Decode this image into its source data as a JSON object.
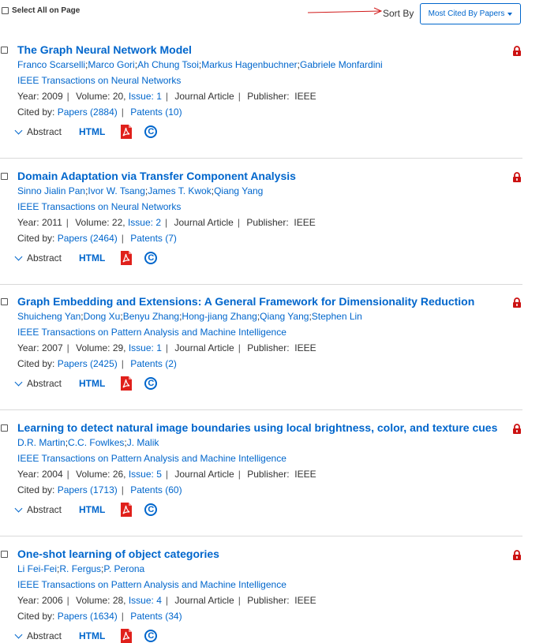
{
  "toolbar": {
    "select_all_label": "Select All on Page",
    "sort_by_label": "Sort By",
    "sort_value": "Most Cited By Papers"
  },
  "labels": {
    "year": "Year:",
    "volume": "Volume:",
    "issue": "Issue:",
    "publisher": "Publisher:",
    "cited_by": "Cited by:",
    "abstract": "Abstract",
    "html": "HTML"
  },
  "colors": {
    "link": "#0066cc",
    "lock": "#cc1111",
    "pdf": "#e0201b",
    "annotation_arrow": "#d11a1a"
  },
  "results": [
    {
      "title": "The Graph Neural Network Model",
      "authors": [
        "Franco Scarselli",
        "Marco Gori",
        "Ah Chung Tsoi",
        "Markus Hagenbuchner",
        "Gabriele Monfardini"
      ],
      "publication": "IEEE Transactions on Neural Networks",
      "year": "2009",
      "volume": "20,",
      "issue": "1",
      "type": "Journal Article",
      "publisher": "IEEE",
      "papers": "Papers (2884)",
      "patents": "Patents (10)"
    },
    {
      "title": "Domain Adaptation via Transfer Component Analysis",
      "authors": [
        "Sinno Jialin Pan",
        "Ivor W. Tsang",
        "James T. Kwok",
        "Qiang Yang"
      ],
      "publication": "IEEE Transactions on Neural Networks",
      "year": "2011",
      "volume": "22,",
      "issue": "2",
      "type": "Journal Article",
      "publisher": "IEEE",
      "papers": "Papers (2464)",
      "patents": "Patents (7)"
    },
    {
      "title": "Graph Embedding and Extensions: A General Framework for Dimensionality Reduction",
      "authors": [
        "Shuicheng Yan",
        "Dong Xu",
        "Benyu Zhang",
        "Hong-jiang Zhang",
        "Qiang Yang",
        "Stephen Lin"
      ],
      "publication": "IEEE Transactions on Pattern Analysis and Machine Intelligence",
      "year": "2007",
      "volume": "29,",
      "issue": "1",
      "type": "Journal Article",
      "publisher": "IEEE",
      "papers": "Papers (2425)",
      "patents": "Patents (2)"
    },
    {
      "title": "Learning to detect natural image boundaries using local brightness, color, and texture cues",
      "authors": [
        "D.R. Martin",
        "C.C. Fowlkes",
        "J. Malik"
      ],
      "publication": "IEEE Transactions on Pattern Analysis and Machine Intelligence",
      "year": "2004",
      "volume": "26,",
      "issue": "5",
      "type": "Journal Article",
      "publisher": "IEEE",
      "papers": "Papers (1713)",
      "patents": "Patents (60)"
    },
    {
      "title": "One-shot learning of object categories",
      "authors": [
        "Li Fei-Fei",
        "R. Fergus",
        "P. Perona"
      ],
      "publication": "IEEE Transactions on Pattern Analysis and Machine Intelligence",
      "year": "2006",
      "volume": "28,",
      "issue": "4",
      "type": "Journal Article",
      "publisher": "IEEE",
      "papers": "Papers (1634)",
      "patents": "Patents (34)"
    }
  ]
}
